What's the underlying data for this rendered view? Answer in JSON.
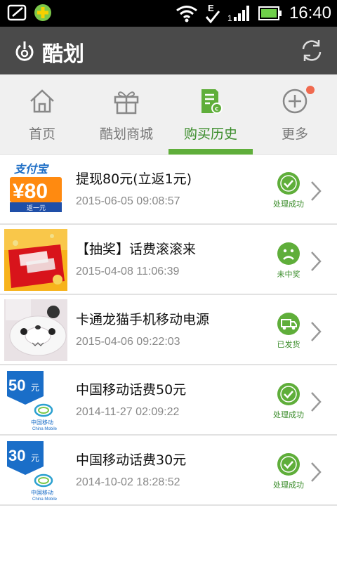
{
  "status_bar": {
    "time": "16:40"
  },
  "app": {
    "title": "酷划"
  },
  "tabs": [
    {
      "label": "首页",
      "icon": "home-icon"
    },
    {
      "label": "酷划商城",
      "icon": "gift-icon"
    },
    {
      "label": "购买历史",
      "icon": "receipt-icon"
    },
    {
      "label": "更多",
      "icon": "plus-circle-icon"
    }
  ],
  "active_tab": 2,
  "colors": {
    "accent": "#5fae3a",
    "appbar": "#4a4a4a",
    "badge": "#f06a4f"
  },
  "orders": [
    {
      "title": "提现80元(立返1元)",
      "time": "2015-06-05 09:08:57",
      "status": "处理成功",
      "status_icon": "check-icon",
      "thumb": {
        "brand": "支付宝",
        "amount": "¥80",
        "sub": "返一元"
      }
    },
    {
      "title": "【抽奖】话费滚滚来",
      "time": "2015-04-08 11:06:39",
      "status": "未中奖",
      "status_icon": "sad-face-icon",
      "thumb": {}
    },
    {
      "title": "卡通龙猫手机移动电源",
      "time": "2015-04-06 09:22:03",
      "status": "已发货",
      "status_icon": "truck-icon",
      "thumb": {}
    },
    {
      "title": "中国移动话费50元",
      "time": "2014-11-27 02:09:22",
      "status": "处理成功",
      "status_icon": "check-icon",
      "thumb": {
        "amount": "50",
        "unit": "元",
        "brand": "中国移动",
        "brand_en": "China Mobile"
      }
    },
    {
      "title": "中国移动话费30元",
      "time": "2014-10-02 18:28:52",
      "status": "处理成功",
      "status_icon": "check-icon",
      "thumb": {
        "amount": "30",
        "unit": "元",
        "brand": "中国移动",
        "brand_en": "China Mobile"
      }
    }
  ]
}
